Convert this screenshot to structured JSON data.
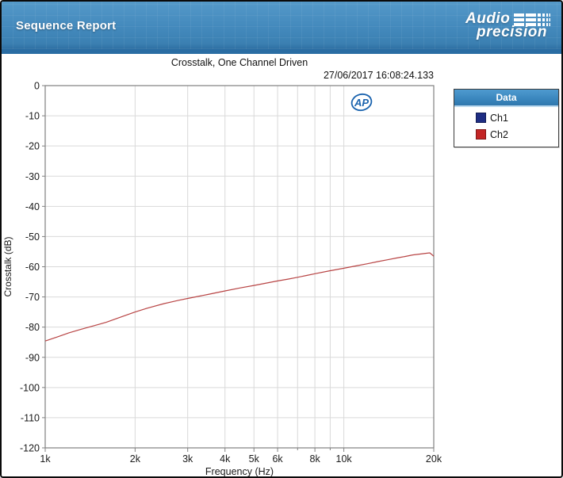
{
  "header": {
    "title": "Sequence Report",
    "brand_line1": "Audio",
    "brand_line2": "precision"
  },
  "chart": {
    "title": "Crosstalk, One Channel Driven",
    "timestamp": "27/06/2017 16:08:24.133",
    "watermark": "AP"
  },
  "legend": {
    "title": "Data",
    "items": [
      {
        "label": "Ch1",
        "color": "#1e2d83"
      },
      {
        "label": "Ch2",
        "color": "#c32525"
      }
    ]
  },
  "colors": {
    "header_blue_top": "#5499c9",
    "header_blue_bottom": "#2e6fa2",
    "header_band": "#2a6da3",
    "legend_header_blue": "#3a86bd",
    "curve_red": "#b84444",
    "gridline": "#d9d9d9",
    "plot_border": "#808080",
    "tick_text": "#1a1a1a",
    "ap_watermark_blue": "#1a63ae"
  },
  "chart_data": {
    "type": "line",
    "title": "Crosstalk, One Channel Driven",
    "xlabel": "Frequency (Hz)",
    "ylabel": "Crosstalk (dB)",
    "x_scale": "log",
    "xlim": [
      1000,
      20000
    ],
    "ylim": [
      -120,
      0
    ],
    "grid": true,
    "legend_position": "right",
    "x_ticks": [
      {
        "v": 1000,
        "label": "1k"
      },
      {
        "v": 2000,
        "label": "2k"
      },
      {
        "v": 3000,
        "label": "3k"
      },
      {
        "v": 4000,
        "label": "4k"
      },
      {
        "v": 5000,
        "label": "5k"
      },
      {
        "v": 6000,
        "label": "6k"
      },
      {
        "v": 8000,
        "label": "8k"
      },
      {
        "v": 10000,
        "label": "10k"
      },
      {
        "v": 20000,
        "label": "20k"
      }
    ],
    "x_gridlines": [
      2000,
      3000,
      4000,
      5000,
      6000,
      7000,
      8000,
      9000,
      10000
    ],
    "x_minor_ticks": [
      7000,
      9000
    ],
    "y_ticks": [
      0,
      -10,
      -20,
      -30,
      -40,
      -50,
      -60,
      -70,
      -80,
      -90,
      -100,
      -110,
      -120
    ],
    "series": [
      {
        "name": "Ch1",
        "color": "#1e2d83",
        "points": []
      },
      {
        "name": "Ch2",
        "color": "#b84444",
        "points": [
          [
            1000,
            -84.6
          ],
          [
            1100,
            -83.2
          ],
          [
            1200,
            -81.9
          ],
          [
            1300,
            -80.9
          ],
          [
            1400,
            -80.0
          ],
          [
            1500,
            -79.2
          ],
          [
            1600,
            -78.4
          ],
          [
            1800,
            -76.6
          ],
          [
            2000,
            -75.0
          ],
          [
            2200,
            -73.7
          ],
          [
            2500,
            -72.2
          ],
          [
            2800,
            -71.1
          ],
          [
            3000,
            -70.5
          ],
          [
            3500,
            -69.2
          ],
          [
            4000,
            -68.0
          ],
          [
            4500,
            -67.0
          ],
          [
            5000,
            -66.2
          ],
          [
            5500,
            -65.4
          ],
          [
            6000,
            -64.7
          ],
          [
            6500,
            -64.1
          ],
          [
            7000,
            -63.5
          ],
          [
            7500,
            -62.9
          ],
          [
            8000,
            -62.3
          ],
          [
            9000,
            -61.3
          ],
          [
            10000,
            -60.5
          ],
          [
            11000,
            -59.7
          ],
          [
            12000,
            -59.0
          ],
          [
            13000,
            -58.3
          ],
          [
            14000,
            -57.7
          ],
          [
            15000,
            -57.1
          ],
          [
            16000,
            -56.6
          ],
          [
            17000,
            -56.1
          ],
          [
            18000,
            -55.8
          ],
          [
            19000,
            -55.5
          ],
          [
            19400,
            -55.4
          ],
          [
            20000,
            -56.5
          ]
        ]
      }
    ]
  }
}
